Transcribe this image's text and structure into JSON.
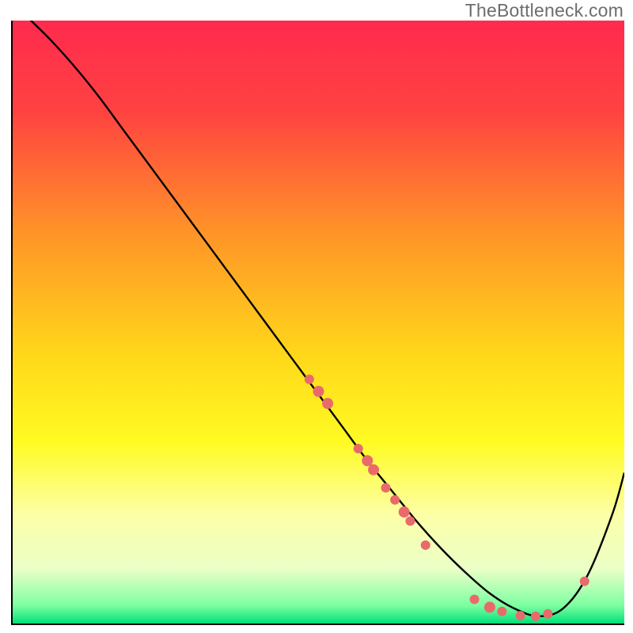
{
  "watermark": "TheBottleneck.com",
  "chart_data": {
    "type": "line",
    "title": "",
    "xlabel": "",
    "ylabel": "",
    "xlim": [
      0,
      100
    ],
    "ylim": [
      0,
      100
    ],
    "gradient_stops": [
      {
        "offset": 0,
        "color": "#ff2a4e"
      },
      {
        "offset": 15,
        "color": "#ff4241"
      },
      {
        "offset": 35,
        "color": "#ff9328"
      },
      {
        "offset": 55,
        "color": "#ffd61a"
      },
      {
        "offset": 70,
        "color": "#fffb23"
      },
      {
        "offset": 82,
        "color": "#fcffa7"
      },
      {
        "offset": 91,
        "color": "#eaffc7"
      },
      {
        "offset": 97,
        "color": "#7dffa1"
      },
      {
        "offset": 100,
        "color": "#00e07a"
      }
    ],
    "series": [
      {
        "name": "bottleneck-curve",
        "x": [
          0,
          3,
          6,
          10,
          14,
          18,
          22,
          26,
          30,
          34,
          38,
          42,
          46,
          50,
          54,
          58,
          62,
          66,
          70,
          74,
          78,
          82,
          86,
          90,
          94,
          98,
          100
        ],
        "y": [
          103,
          100,
          97,
          92.5,
          87.5,
          82,
          76.5,
          71,
          65.5,
          60,
          54.5,
          49,
          43.5,
          38,
          32.5,
          27,
          22,
          17,
          12.5,
          8.5,
          5,
          2.5,
          1.2,
          2.5,
          8,
          18,
          25
        ]
      }
    ],
    "markers": {
      "name": "data-points",
      "color": "#e96a6b",
      "points": [
        {
          "x": 48.5,
          "y": 40.5,
          "r": 6
        },
        {
          "x": 50.0,
          "y": 38.5,
          "r": 7
        },
        {
          "x": 51.5,
          "y": 36.5,
          "r": 7
        },
        {
          "x": 56.5,
          "y": 29.0,
          "r": 6
        },
        {
          "x": 58.0,
          "y": 27.0,
          "r": 7
        },
        {
          "x": 59.0,
          "y": 25.5,
          "r": 7
        },
        {
          "x": 61.0,
          "y": 22.5,
          "r": 6
        },
        {
          "x": 62.5,
          "y": 20.5,
          "r": 6
        },
        {
          "x": 64.0,
          "y": 18.5,
          "r": 7
        },
        {
          "x": 65.0,
          "y": 17.0,
          "r": 6
        },
        {
          "x": 67.5,
          "y": 13.0,
          "r": 6
        },
        {
          "x": 75.5,
          "y": 4.0,
          "r": 6
        },
        {
          "x": 78.0,
          "y": 2.7,
          "r": 7
        },
        {
          "x": 80.0,
          "y": 2.0,
          "r": 6
        },
        {
          "x": 83.0,
          "y": 1.3,
          "r": 6
        },
        {
          "x": 85.5,
          "y": 1.2,
          "r": 6
        },
        {
          "x": 87.5,
          "y": 1.6,
          "r": 6
        },
        {
          "x": 93.5,
          "y": 7.0,
          "r": 6
        }
      ]
    }
  }
}
